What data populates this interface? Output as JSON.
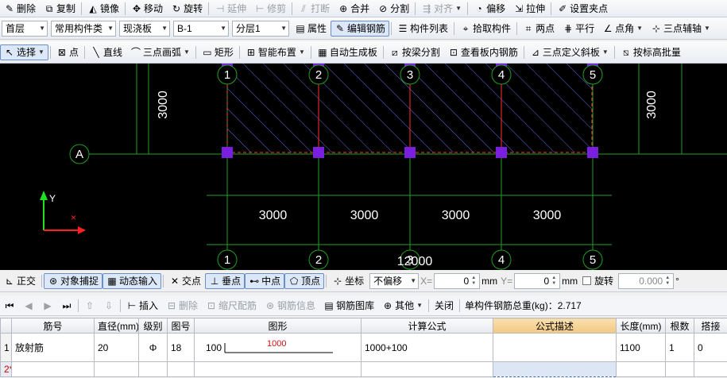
{
  "toolbar1": [
    {
      "icon": "pencil-erase-icon",
      "g": "✎",
      "label": "删除"
    },
    {
      "icon": "copy-icon",
      "g": "⧉",
      "label": "复制"
    },
    {
      "icon": "mirror-icon",
      "g": "◭",
      "label": "镜像"
    },
    {
      "icon": "move-icon",
      "g": "✥",
      "label": "移动"
    },
    {
      "icon": "rotate-icon",
      "g": "↻",
      "label": "旋转"
    },
    {
      "icon": "extend-icon",
      "g": "⊣",
      "label": "延伸",
      "dim": true
    },
    {
      "icon": "trim-icon",
      "g": "⊢",
      "label": "修剪",
      "dim": true
    },
    {
      "icon": "break-icon",
      "g": "⫽",
      "label": "打断",
      "dim": true
    },
    {
      "icon": "merge-icon",
      "g": "⊕",
      "label": "合并"
    },
    {
      "icon": "split-icon",
      "g": "⊘",
      "label": "分割"
    },
    {
      "icon": "align-icon",
      "g": "⇶",
      "label": "对齐",
      "dim": true,
      "caret": true
    },
    {
      "icon": "offset-icon",
      "g": "◔",
      "label": "偏移"
    },
    {
      "icon": "stretch-icon",
      "g": "⇲",
      "label": "拉伸"
    },
    {
      "icon": "set-pivot-icon",
      "g": "✐",
      "label": "设置夹点"
    }
  ],
  "toolbar2": {
    "floor": "首层",
    "component_type": "常用构件类",
    "category": "现浇板",
    "component_name": "B-1",
    "layer": "分层1",
    "buttons": [
      {
        "icon": "properties-icon",
        "g": "▤",
        "label": "属性"
      },
      {
        "icon": "edit-rebar-icon",
        "g": "✎",
        "label": "编辑钢筋",
        "active": true
      },
      {
        "icon": "component-list-icon",
        "g": "☰",
        "label": "构件列表"
      },
      {
        "icon": "pick-component-icon",
        "g": "⌖",
        "label": "拾取构件"
      },
      {
        "icon": "two-point-icon",
        "g": "⌗",
        "label": "两点"
      },
      {
        "icon": "parallel-icon",
        "g": "⋕",
        "label": "平行"
      },
      {
        "icon": "point-angle-icon",
        "g": "∠",
        "label": "点角",
        "caret": true
      },
      {
        "icon": "three-point-aux-icon",
        "g": "⊹",
        "label": "三点辅轴",
        "caret": true
      }
    ]
  },
  "toolbar3": [
    {
      "icon": "select-cursor-icon",
      "g": "↖",
      "label": "选择",
      "active": true,
      "caret": true
    },
    {
      "icon": "point-icon",
      "g": "⊠",
      "label": "点"
    },
    {
      "icon": "line-icon",
      "g": "╲",
      "label": "直线"
    },
    {
      "icon": "arc-icon",
      "g": "⌒",
      "label": "三点画弧",
      "caret": true
    },
    {
      "icon": "rectangle-icon",
      "g": "▭",
      "label": "矩形"
    },
    {
      "icon": "smart-layout-icon",
      "g": "⊞",
      "label": "智能布置",
      "caret": true
    },
    {
      "icon": "auto-slab-icon",
      "g": "▦",
      "label": "自动生成板"
    },
    {
      "icon": "split-by-beam-icon",
      "g": "⧄",
      "label": "按梁分割"
    },
    {
      "icon": "view-rebar-icon",
      "g": "⊡",
      "label": "查看板内钢筋"
    },
    {
      "icon": "slope-icon",
      "g": "⊿",
      "label": "三点定义斜板",
      "caret": true
    },
    {
      "icon": "slope-by-elevation-icon",
      "g": "⧅",
      "label": "按标高批量"
    }
  ],
  "canvas": {
    "axis_top": [
      "1",
      "2",
      "3",
      "4",
      "5"
    ],
    "axis_bottom": [
      "1",
      "2",
      "3",
      "4",
      "5"
    ],
    "axis_left": "A",
    "dim_vertical": "3000",
    "dims_horizontal": [
      "3000",
      "3000",
      "3000",
      "3000"
    ],
    "dim_total": "12000",
    "dim_red": "1000",
    "ucs_y": "Y",
    "colors": {
      "grid": "#1fa01f",
      "slab_edge": "#ff4040",
      "hatch": "#6a6ae8",
      "grip": "#7a1fe0",
      "text": "#ffffff",
      "ucs_x": "#ff2020",
      "ucs_y": "#20e020"
    }
  },
  "snapbar": {
    "buttons": [
      {
        "icon": "ortho-icon",
        "g": "⊾",
        "label": "正交"
      },
      {
        "icon": "object-snap-icon",
        "g": "⊛",
        "label": "对象捕捉",
        "active": true
      },
      {
        "icon": "dynamic-input-icon",
        "g": "▦",
        "label": "动态输入",
        "active": true
      },
      {
        "icon": "intersection-icon",
        "g": "✕",
        "label": "交点"
      },
      {
        "icon": "perpendicular-icon",
        "g": "⊥",
        "label": "垂点",
        "active": true
      },
      {
        "icon": "midpoint-icon",
        "g": "⊷",
        "label": "中点",
        "active": true
      },
      {
        "icon": "vertex-icon",
        "g": "⬠",
        "label": "顶点",
        "active": true
      },
      {
        "icon": "coordinate-icon",
        "g": "⊹",
        "label": "坐标"
      }
    ],
    "offset_mode": "不偏移",
    "x_label": "X=",
    "x_value": "0",
    "y_label": "Y=",
    "y_value": "0",
    "unit": "mm",
    "rotate_label": "旋转",
    "rotate_value": "0.000",
    "degree": "°"
  },
  "rebar_toolbar": {
    "nav": [
      {
        "icon": "first-icon",
        "g": "⏮"
      },
      {
        "icon": "prev-icon",
        "g": "◀",
        "dim": true
      },
      {
        "icon": "next-icon",
        "g": "▶",
        "dim": true
      },
      {
        "icon": "last-icon",
        "g": "⏭"
      }
    ],
    "buttons": [
      {
        "icon": "move-up-icon",
        "g": "⇧",
        "label": "",
        "dim": true
      },
      {
        "icon": "move-down-icon",
        "g": "⇩",
        "label": "",
        "dim": true
      },
      {
        "icon": "insert-icon",
        "g": "⊢",
        "label": "插入"
      },
      {
        "icon": "delete-icon",
        "g": "⊟",
        "label": "删除",
        "dim": true
      },
      {
        "icon": "scale-rebar-icon",
        "g": "⊡",
        "label": "缩尺配筋",
        "dim": true
      },
      {
        "icon": "rebar-info-icon",
        "g": "⊛",
        "label": "钢筋信息",
        "dim": true
      },
      {
        "icon": "rebar-library-icon",
        "g": "▤",
        "label": "钢筋图库"
      },
      {
        "icon": "other-icon",
        "g": "⊕",
        "label": "其他",
        "caret": true
      },
      {
        "icon": "",
        "g": "",
        "label": "关闭"
      }
    ],
    "total_weight": "单构件钢筋总重(kg)：2.717"
  },
  "rebar_table": {
    "headers": [
      "",
      "筋号",
      "直径(mm)",
      "级别",
      "图号",
      "图形",
      "计算公式",
      "公式描述",
      "长度(mm)",
      "根数",
      "搭接"
    ],
    "rows": [
      {
        "num": "1",
        "name": "放射筋",
        "diameter": "20",
        "grade": "Φ",
        "figure_no": "18",
        "shape_left": "100",
        "shape_label": "1000",
        "formula": "1000+100",
        "description": "",
        "length": "1100",
        "count": "1",
        "lap": "0"
      },
      {
        "num": "2*",
        "name": "",
        "diameter": "",
        "grade": "",
        "figure_no": "",
        "shape_left": "",
        "shape_label": "",
        "formula": "",
        "description": "",
        "length": "",
        "count": "",
        "lap": ""
      }
    ]
  }
}
